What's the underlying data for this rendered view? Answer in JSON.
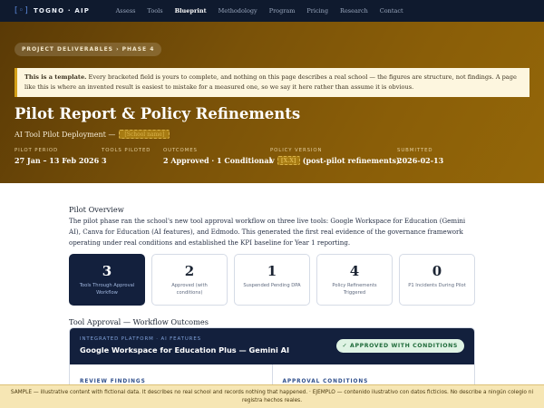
{
  "nav": {
    "brand": "TOGNO · AIP",
    "logo_glyph": "[◦]",
    "links": [
      "Assess",
      "Tools",
      "Blueprint",
      "Methodology",
      "Program",
      "Pricing",
      "Research",
      "Contact"
    ],
    "active": "Blueprint"
  },
  "hero": {
    "breadcrumb": "PROJECT DELIVERABLES  ›  PHASE 4",
    "notice_bold": "This is a template.",
    "notice_text": " Every bracketed field is yours to complete, and nothing on this page describes a real school — the figures are structure, not findings. A page like this is where an invented result is easiest to mistake for a measured one, so we say it here rather than assume it is obvious.",
    "title": "Pilot Report & Policy Refinements",
    "subtitle": "AI Tool Pilot Deployment —",
    "subtitle_slot": "[School name]",
    "meta": [
      {
        "label": "PILOT PERIOD",
        "value": "27 Jan – 13 Feb 2026"
      },
      {
        "label": "TOOLS PILOTED",
        "value": "3"
      },
      {
        "label": "OUTCOMES",
        "value": "2 Approved · 1 Conditional"
      },
      {
        "label": "POLICY VERSION",
        "value_prefix": "v",
        "value_slot": "[X.X]",
        "value_suffix": "(post-pilot refinements)"
      },
      {
        "label": "SUBMITTED",
        "value": "2026-02-13"
      }
    ]
  },
  "overview": {
    "heading": "Pilot Overview",
    "text": "The pilot phase ran the school's new tool approval workflow on three live tools: Google Workspace for Education (Gemini AI), Canva for Education (AI features), and Edmodo. This generated the first real evidence of the governance framework operating under real conditions and established the KPI baseline for Year 1 reporting."
  },
  "kpis": [
    {
      "num": "3",
      "label": "Tools Through Approval Workflow"
    },
    {
      "num": "2",
      "label": "Approved (with conditions)"
    },
    {
      "num": "1",
      "label": "Suspended Pending DPA"
    },
    {
      "num": "4",
      "label": "Policy Refinements Triggered"
    },
    {
      "num": "0",
      "label": "P1 Incidents During Pilot"
    }
  ],
  "outcomes": {
    "heading": "Tool Approval — Workflow Outcomes",
    "card": {
      "kicker": "INTEGRATED PLATFORM · AI FEATURES",
      "name": "Google Workspace for Education Plus — Gemini AI",
      "badge": "✓ APPROVED WITH CONDITIONS",
      "col_left": "REVIEW FINDINGS",
      "col_right": "APPROVAL CONDITIONS"
    }
  },
  "sample_banner": "SAMPLE — illustrative content with fictional data. It describes no real school and records nothing that happened. · EJEMPLO — contenido ilustrativo con datos ficticios. No describe a ningún colegio ni registra hechos reales.",
  "colors": {
    "nav_bg": "#0f1a2e",
    "hero_gold": "#8a5e08",
    "navy_card": "#13203d",
    "approved_green": "#1f6b3a"
  }
}
